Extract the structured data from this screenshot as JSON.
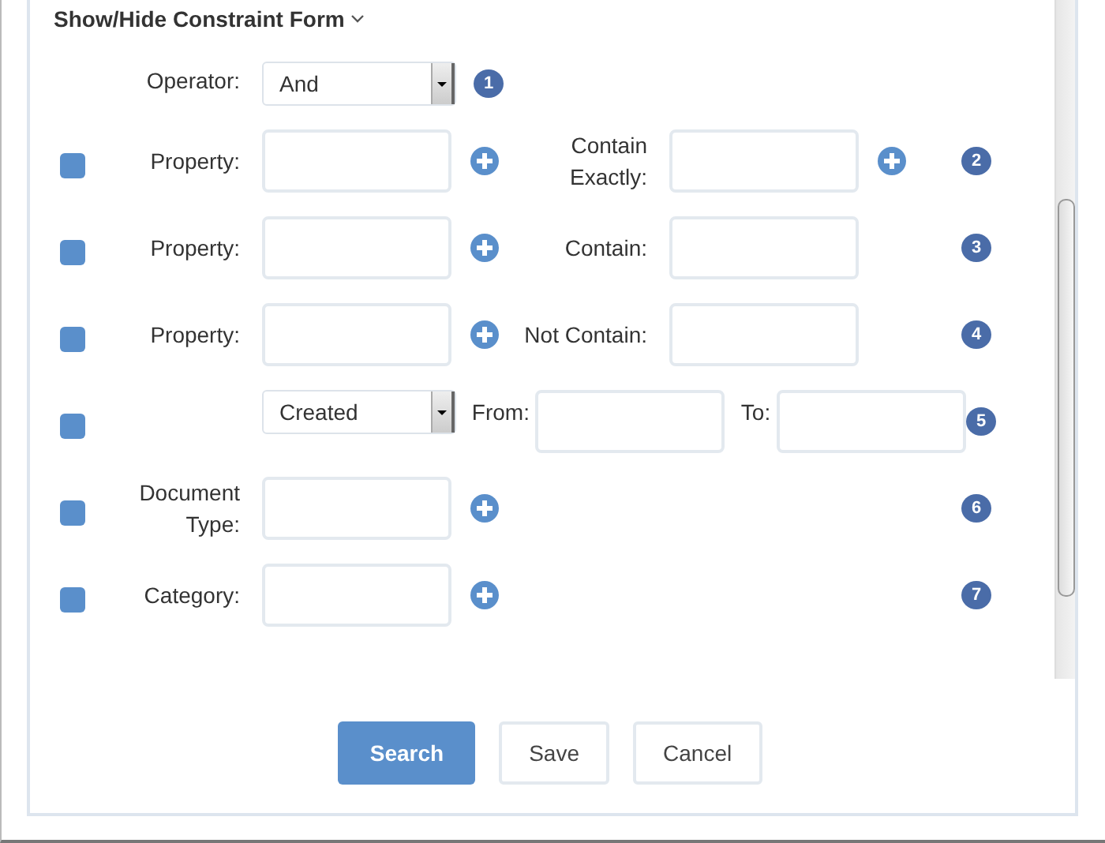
{
  "title": "Show/Hide Constraint Form",
  "operator": {
    "label": "Operator:",
    "value": "And",
    "badge": "1"
  },
  "constraints": [
    {
      "kind": "pair",
      "checked": false,
      "label": "Property:",
      "add": true,
      "value_label": "Contain Exactly:",
      "value_add": true,
      "badge": "2"
    },
    {
      "kind": "pair",
      "checked": false,
      "label": "Property:",
      "add": true,
      "value_label": "Contain:",
      "value_add": false,
      "badge": "3"
    },
    {
      "kind": "pair",
      "checked": false,
      "label": "Property:",
      "add": true,
      "value_label": "Not Contain:",
      "value_add": false,
      "badge": "4"
    },
    {
      "kind": "date",
      "checked": false,
      "value": "Created",
      "from_label": "From:",
      "to_label": "To:",
      "badge": "5"
    },
    {
      "kind": "single",
      "checked": false,
      "label": "Document Type:",
      "add": true,
      "badge": "6"
    },
    {
      "kind": "single",
      "checked": false,
      "label": "Category:",
      "add": true,
      "badge": "7"
    }
  ],
  "buttons": [
    {
      "kind": "primary",
      "label": "Search"
    },
    {
      "kind": "default",
      "label": "Save"
    },
    {
      "kind": "default",
      "label": "Cancel"
    }
  ]
}
